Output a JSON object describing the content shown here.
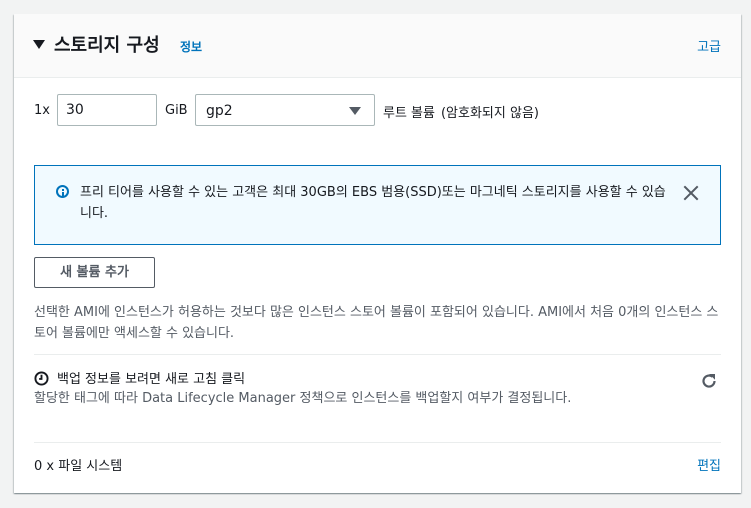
{
  "header": {
    "title": "스토리지 구성",
    "info_label": "정보",
    "advanced_label": "고급"
  },
  "volume": {
    "count_label": "1x",
    "size_value": "30",
    "unit_label": "GiB",
    "type_value": "gp2",
    "root_label": "루트 볼륨",
    "root_sub": "(암호화되지 않음)"
  },
  "alert": {
    "text": "프리 티어를 사용할 수 있는 고객은 최대 30GB의 EBS 범용(SSD)또는 마그네틱 스토리지를 사용할 수 있습니다."
  },
  "add_volume_label": "새 볼륨 추가",
  "instance_store_desc": "선택한 AMI에 인스턴스가 허용하는 것보다 많은 인스턴스 스토어 볼륨이 포함되어 있습니다. AMI에서 처음 0개의 인스턴스 스토어 볼륨에만 액세스할 수 있습니다.",
  "backup": {
    "title": "백업 정보를 보려면 새로 고침 클릭",
    "desc": "할당한 태그에 따라 Data Lifecycle Manager 정책으로 인스턴스를 백업할지 여부가 결정됩니다."
  },
  "filesystem": {
    "label": "0 x 파일 시스템",
    "edit_label": "편집"
  },
  "colors": {
    "link": "#0073bb",
    "alert_bg": "#f1faff",
    "alert_border": "#0073bb"
  },
  "icons": [
    "caret-down-icon",
    "info-icon",
    "close-icon",
    "clock-icon",
    "refresh-icon",
    "select-arrow-icon"
  ]
}
